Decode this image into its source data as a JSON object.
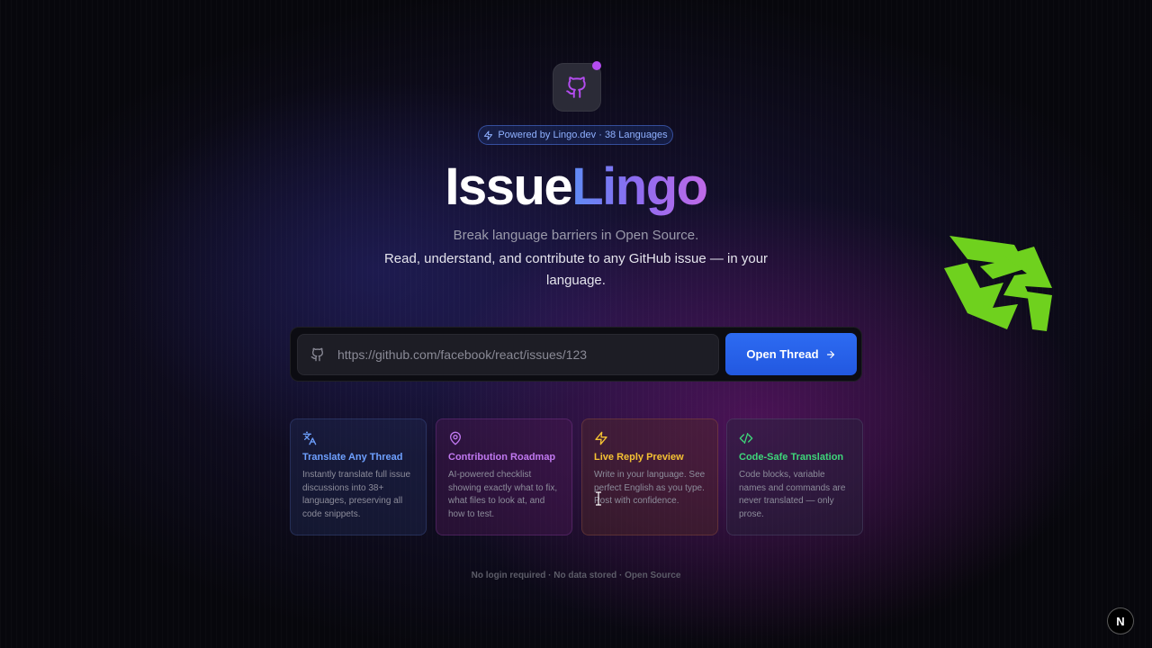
{
  "app": {
    "badge_text": "Powered by Lingo.dev · 38 Languages",
    "title_part1": "Issue",
    "title_part2": "Lingo",
    "subtitle": "Break language barriers in Open Source.",
    "tagline": "Read, understand, and contribute to any GitHub issue — in your language."
  },
  "search": {
    "placeholder": "https://github.com/facebook/react/issues/123",
    "value": "",
    "button_label": "Open Thread",
    "icon": "github-icon"
  },
  "features": [
    {
      "icon": "translate-icon",
      "title": "Translate Any Thread",
      "description": "Instantly translate full issue discussions into 38+ languages, preserving all code snippets.",
      "accent": "#6ea0ff"
    },
    {
      "icon": "map-pin-icon",
      "title": "Contribution Roadmap",
      "description": "AI-powered checklist showing exactly what to fix, what files to look at, and how to test.",
      "accent": "#c078f0"
    },
    {
      "icon": "lightning-icon",
      "title": "Live Reply Preview",
      "description": "Write in your language. See perfect English as you type. Post with confidence.",
      "accent": "#f5c233"
    },
    {
      "icon": "code-icon",
      "title": "Code-Safe Translation",
      "description": "Code blocks, variable names and commands are never translated — only prose.",
      "accent": "#3ed67a"
    }
  ],
  "footer": {
    "note": "No login required · No data stored · Open Source"
  },
  "dev_indicator": {
    "label": "N"
  },
  "colors": {
    "primary_button": "#2d6bf2",
    "badge_text": "#8fb0ff",
    "logo_dot": "#b44cf0",
    "floating_logo": "#6fd11e"
  }
}
